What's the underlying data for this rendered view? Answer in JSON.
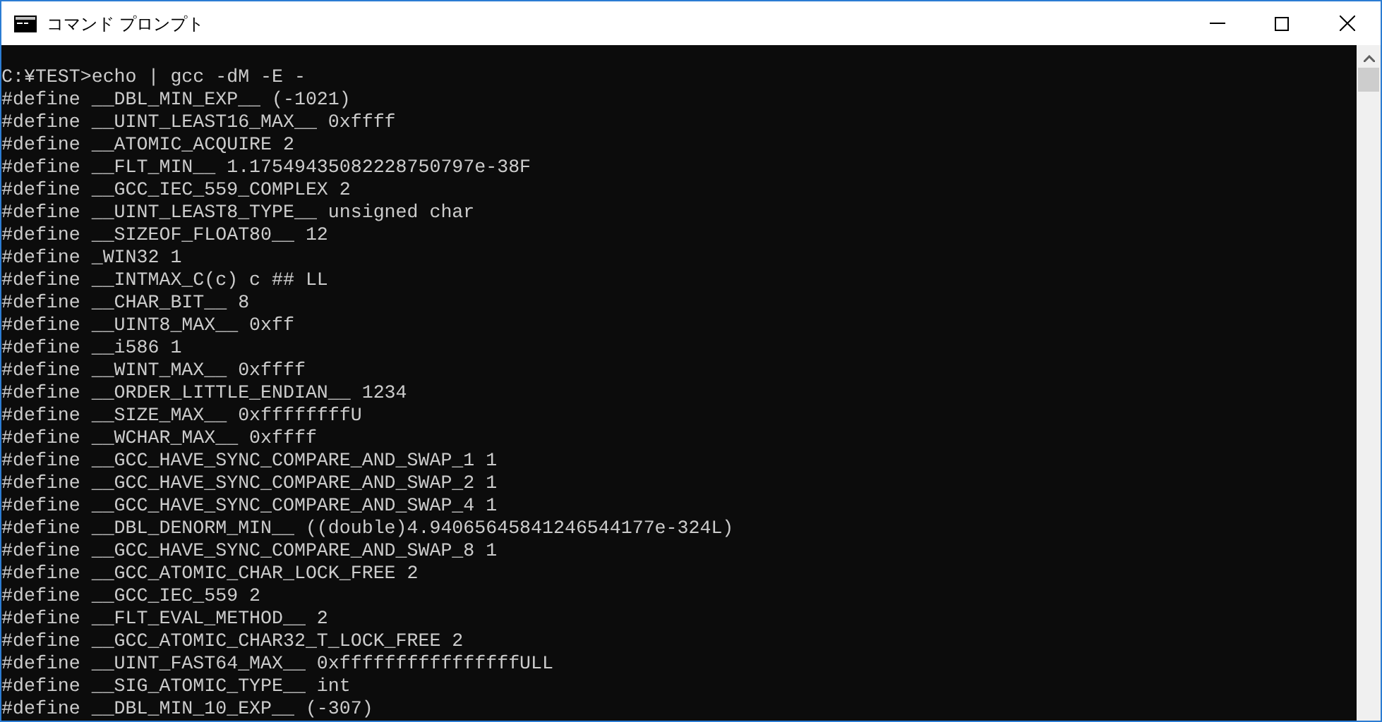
{
  "window": {
    "title": "コマンド プロンプト"
  },
  "console": {
    "lines": [
      "C:¥TEST>echo | gcc -dM -E -",
      "#define __DBL_MIN_EXP__ (-1021)",
      "#define __UINT_LEAST16_MAX__ 0xffff",
      "#define __ATOMIC_ACQUIRE 2",
      "#define __FLT_MIN__ 1.17549435082228750797e-38F",
      "#define __GCC_IEC_559_COMPLEX 2",
      "#define __UINT_LEAST8_TYPE__ unsigned char",
      "#define __SIZEOF_FLOAT80__ 12",
      "#define _WIN32 1",
      "#define __INTMAX_C(c) c ## LL",
      "#define __CHAR_BIT__ 8",
      "#define __UINT8_MAX__ 0xff",
      "#define __i586 1",
      "#define __WINT_MAX__ 0xffff",
      "#define __ORDER_LITTLE_ENDIAN__ 1234",
      "#define __SIZE_MAX__ 0xffffffffU",
      "#define __WCHAR_MAX__ 0xffff",
      "#define __GCC_HAVE_SYNC_COMPARE_AND_SWAP_1 1",
      "#define __GCC_HAVE_SYNC_COMPARE_AND_SWAP_2 1",
      "#define __GCC_HAVE_SYNC_COMPARE_AND_SWAP_4 1",
      "#define __DBL_DENORM_MIN__ ((double)4.94065645841246544177e-324L)",
      "#define __GCC_HAVE_SYNC_COMPARE_AND_SWAP_8 1",
      "#define __GCC_ATOMIC_CHAR_LOCK_FREE 2",
      "#define __GCC_IEC_559 2",
      "#define __FLT_EVAL_METHOD__ 2",
      "#define __GCC_ATOMIC_CHAR32_T_LOCK_FREE 2",
      "#define __UINT_FAST64_MAX__ 0xffffffffffffffffULL",
      "#define __SIG_ATOMIC_TYPE__ int",
      "#define __DBL_MIN_10_EXP__ (-307)"
    ]
  }
}
